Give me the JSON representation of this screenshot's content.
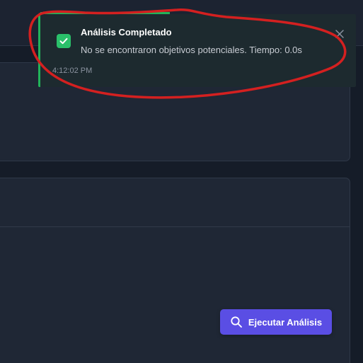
{
  "toast": {
    "title": "Análisis Completado",
    "message": "No se encontraron objetivos potenciales. Tiempo: 0.0s",
    "time": "4:12:02 PM",
    "icon": "check-icon",
    "close_icon": "close-icon",
    "accent": "#22b35a"
  },
  "actions": {
    "run_label": "Ejecutar Análisis",
    "run_icon": "search-icon",
    "accent": "#5a4ee4"
  },
  "annotation": {
    "color": "#d42020"
  }
}
